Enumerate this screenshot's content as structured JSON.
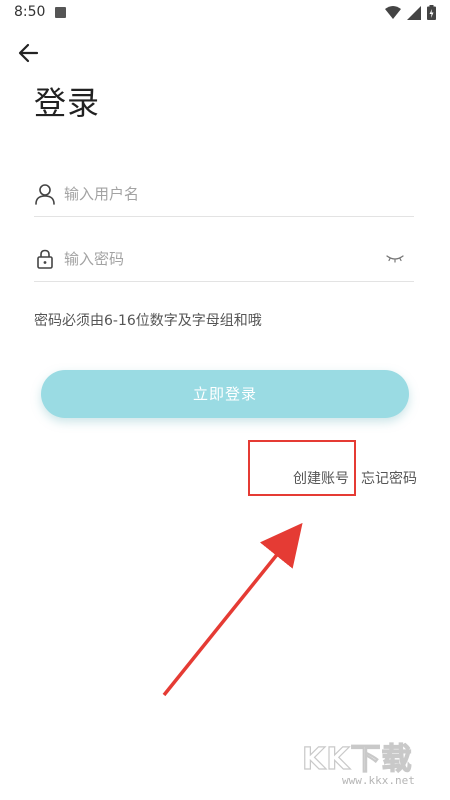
{
  "status_bar": {
    "time": "8:50"
  },
  "header": {
    "title": "登录"
  },
  "form": {
    "username_placeholder": "输入用户名",
    "password_placeholder": "输入密码",
    "password_hint": "密码必须由6-16位数字及字母组和哦",
    "login_button": "立即登录"
  },
  "links": {
    "create_account": "创建账号",
    "forgot_password": "忘记密码"
  },
  "watermark": {
    "brand": "KK下载",
    "url": "www.kkx.net"
  },
  "colors": {
    "primary_button": "#9adbe3",
    "annotation": "#e53b34"
  }
}
